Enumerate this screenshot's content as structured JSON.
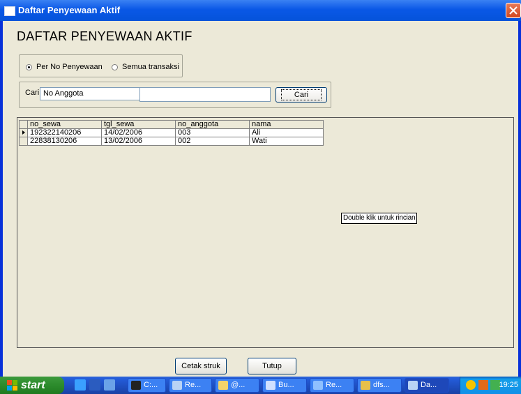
{
  "window": {
    "title": "Daftar Penyewaan Aktif"
  },
  "heading": "DAFTAR PENYEWAAN AKTIF",
  "radio": {
    "option1": "Per No Penyewaan",
    "option2": "Semua transaksi",
    "selected": "option1"
  },
  "search": {
    "label": "Cari",
    "field_value": "No Anggota",
    "text_value": "",
    "button_label": "Cari"
  },
  "grid": {
    "columns": [
      "no_sewa",
      "tgl_sewa",
      "no_anggota",
      "nama"
    ],
    "rows": [
      [
        "192322140206",
        "14/02/2006",
        "003",
        "Ali"
      ],
      [
        "22838130206",
        "13/02/2006",
        "002",
        "Wati"
      ]
    ]
  },
  "hint": "Double klik untuk rincian",
  "buttons": {
    "print_label": "Cetak struk",
    "close_label": "Tutup"
  },
  "taskbar": {
    "start_label": "start",
    "items": [
      "C:...",
      "Re...",
      "@...",
      "Bu...",
      "Re...",
      "dfs...",
      "Da..."
    ],
    "clock": "19:25"
  }
}
